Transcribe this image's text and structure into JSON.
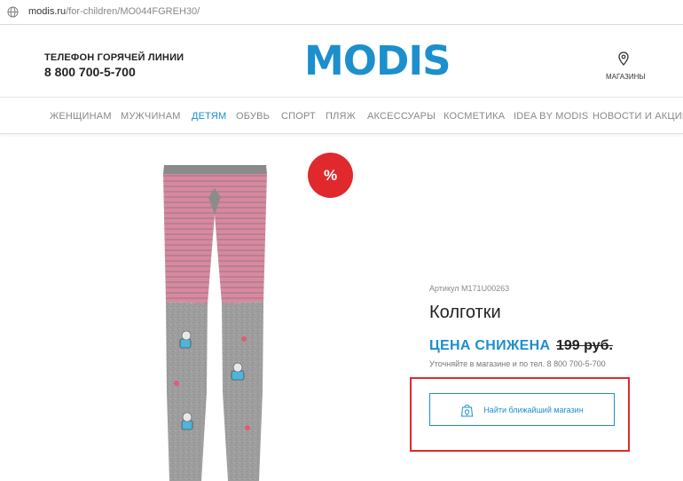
{
  "browser": {
    "url_domain": "modis.ru",
    "url_path": "/for-children/MO044FGREH30/",
    "icon": "globe-icon"
  },
  "header": {
    "hotline_label": "ТЕЛЕФОН ГОРЯЧЕЙ ЛИНИИ",
    "hotline_number": "8 800 700-5-700",
    "logo_text": "MODIS",
    "stores_label": "МАГАЗИНЫ",
    "stores_icon": "map-pin-icon"
  },
  "nav": {
    "items": [
      {
        "label": "ЖЕНЩИНАМ"
      },
      {
        "label": "МУЖЧИНАМ"
      },
      {
        "label": "ДЕТЯМ"
      },
      {
        "label": "ОБУВЬ"
      },
      {
        "label": "СПОРТ"
      },
      {
        "label": "ПЛЯЖ"
      },
      {
        "label": "АКСЕССУАРЫ"
      },
      {
        "label": "КОСМЕТИКА"
      },
      {
        "label": "IDEA BY MODIS"
      },
      {
        "label": "НОВОСТИ И АКЦИИ"
      }
    ],
    "active_index": 2
  },
  "product": {
    "sale_badge": "%",
    "sku_label": "Артикул M171U00263",
    "title": "Колготки",
    "price_reduced_label": "ЦЕНА СНИЖЕНА",
    "old_price": "199 руб.",
    "price_note": "Уточняйте в магазине и по тел. 8 800 700-5-700",
    "store_button_label": "Найти ближайший магазин",
    "store_button_icon": "shopping-bag-pin-icon",
    "image_icon": "tights-image"
  },
  "colors": {
    "brand_blue": "#1c8fcd",
    "sale_red": "#e0292c",
    "highlight_red": "#e0292c",
    "nav_active": "#1c8fcd"
  }
}
